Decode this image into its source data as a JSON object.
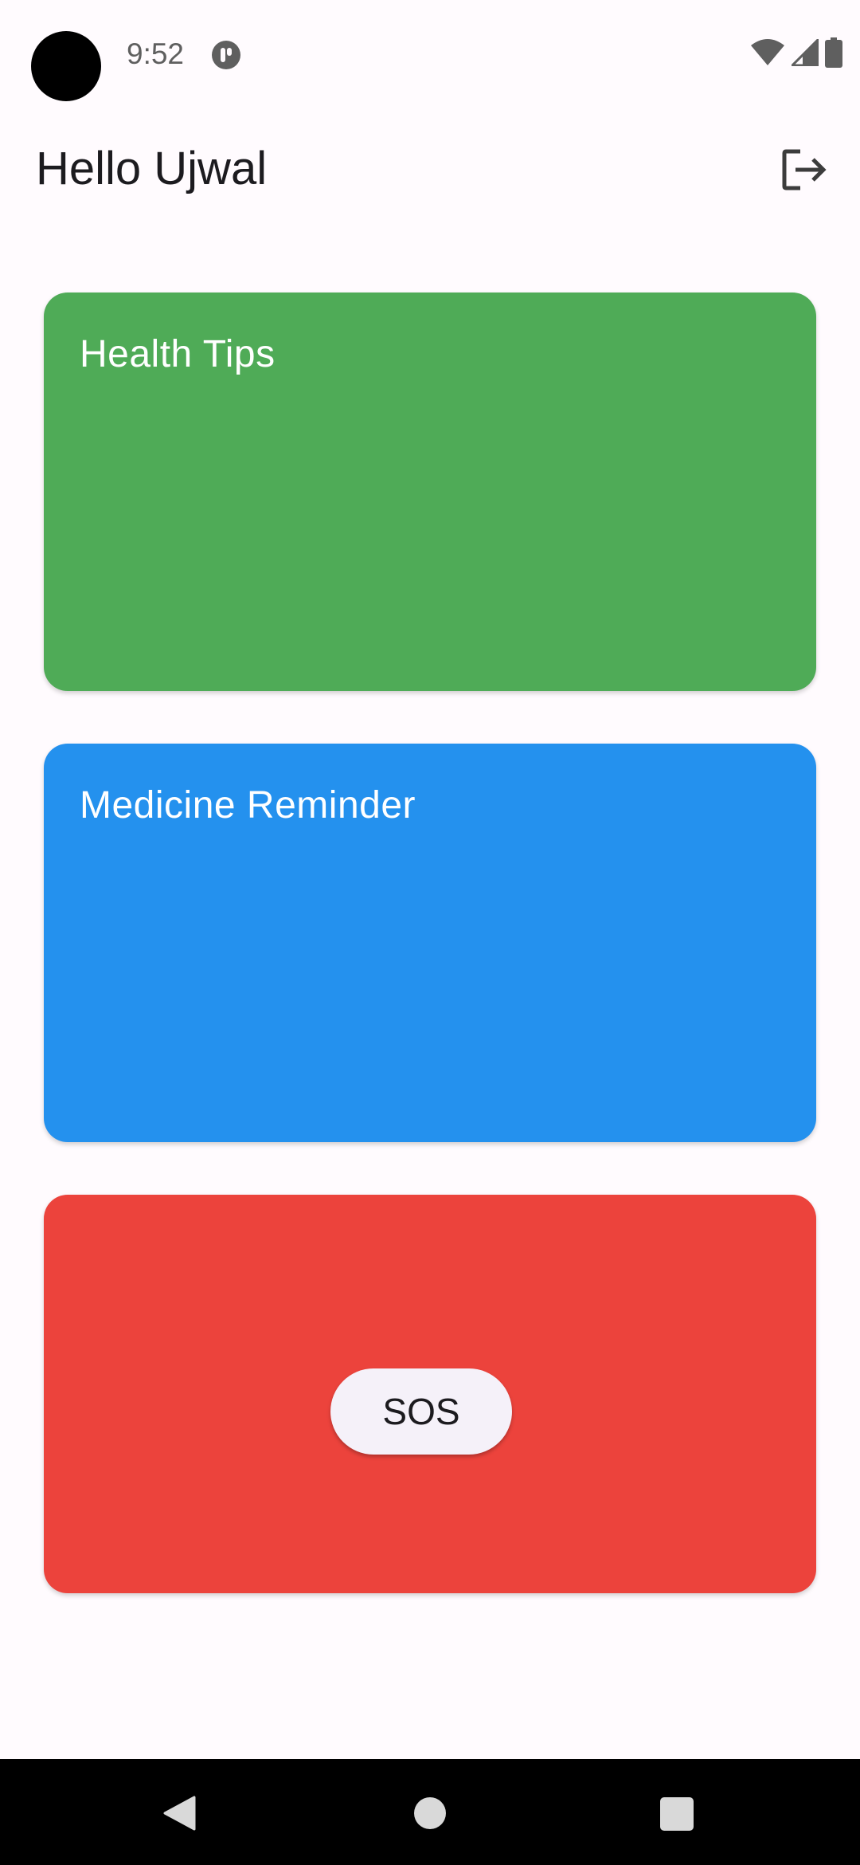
{
  "status_bar": {
    "time": "9:52",
    "icons": [
      "camera-cutout",
      "app-notification-icon",
      "wifi-icon",
      "signal-icon",
      "battery-icon"
    ]
  },
  "app_bar": {
    "greeting": "Hello Ujwal",
    "logout_icon": "logout-icon"
  },
  "cards": {
    "health": {
      "title": "Health Tips",
      "color": "#4fab57"
    },
    "medicine": {
      "title": "Medicine Reminder",
      "color": "#2491ee"
    },
    "sos": {
      "color": "#ec433c",
      "button_label": "SOS"
    }
  },
  "nav_bar": {
    "icons": [
      "back-icon",
      "home-icon",
      "recents-icon"
    ]
  }
}
